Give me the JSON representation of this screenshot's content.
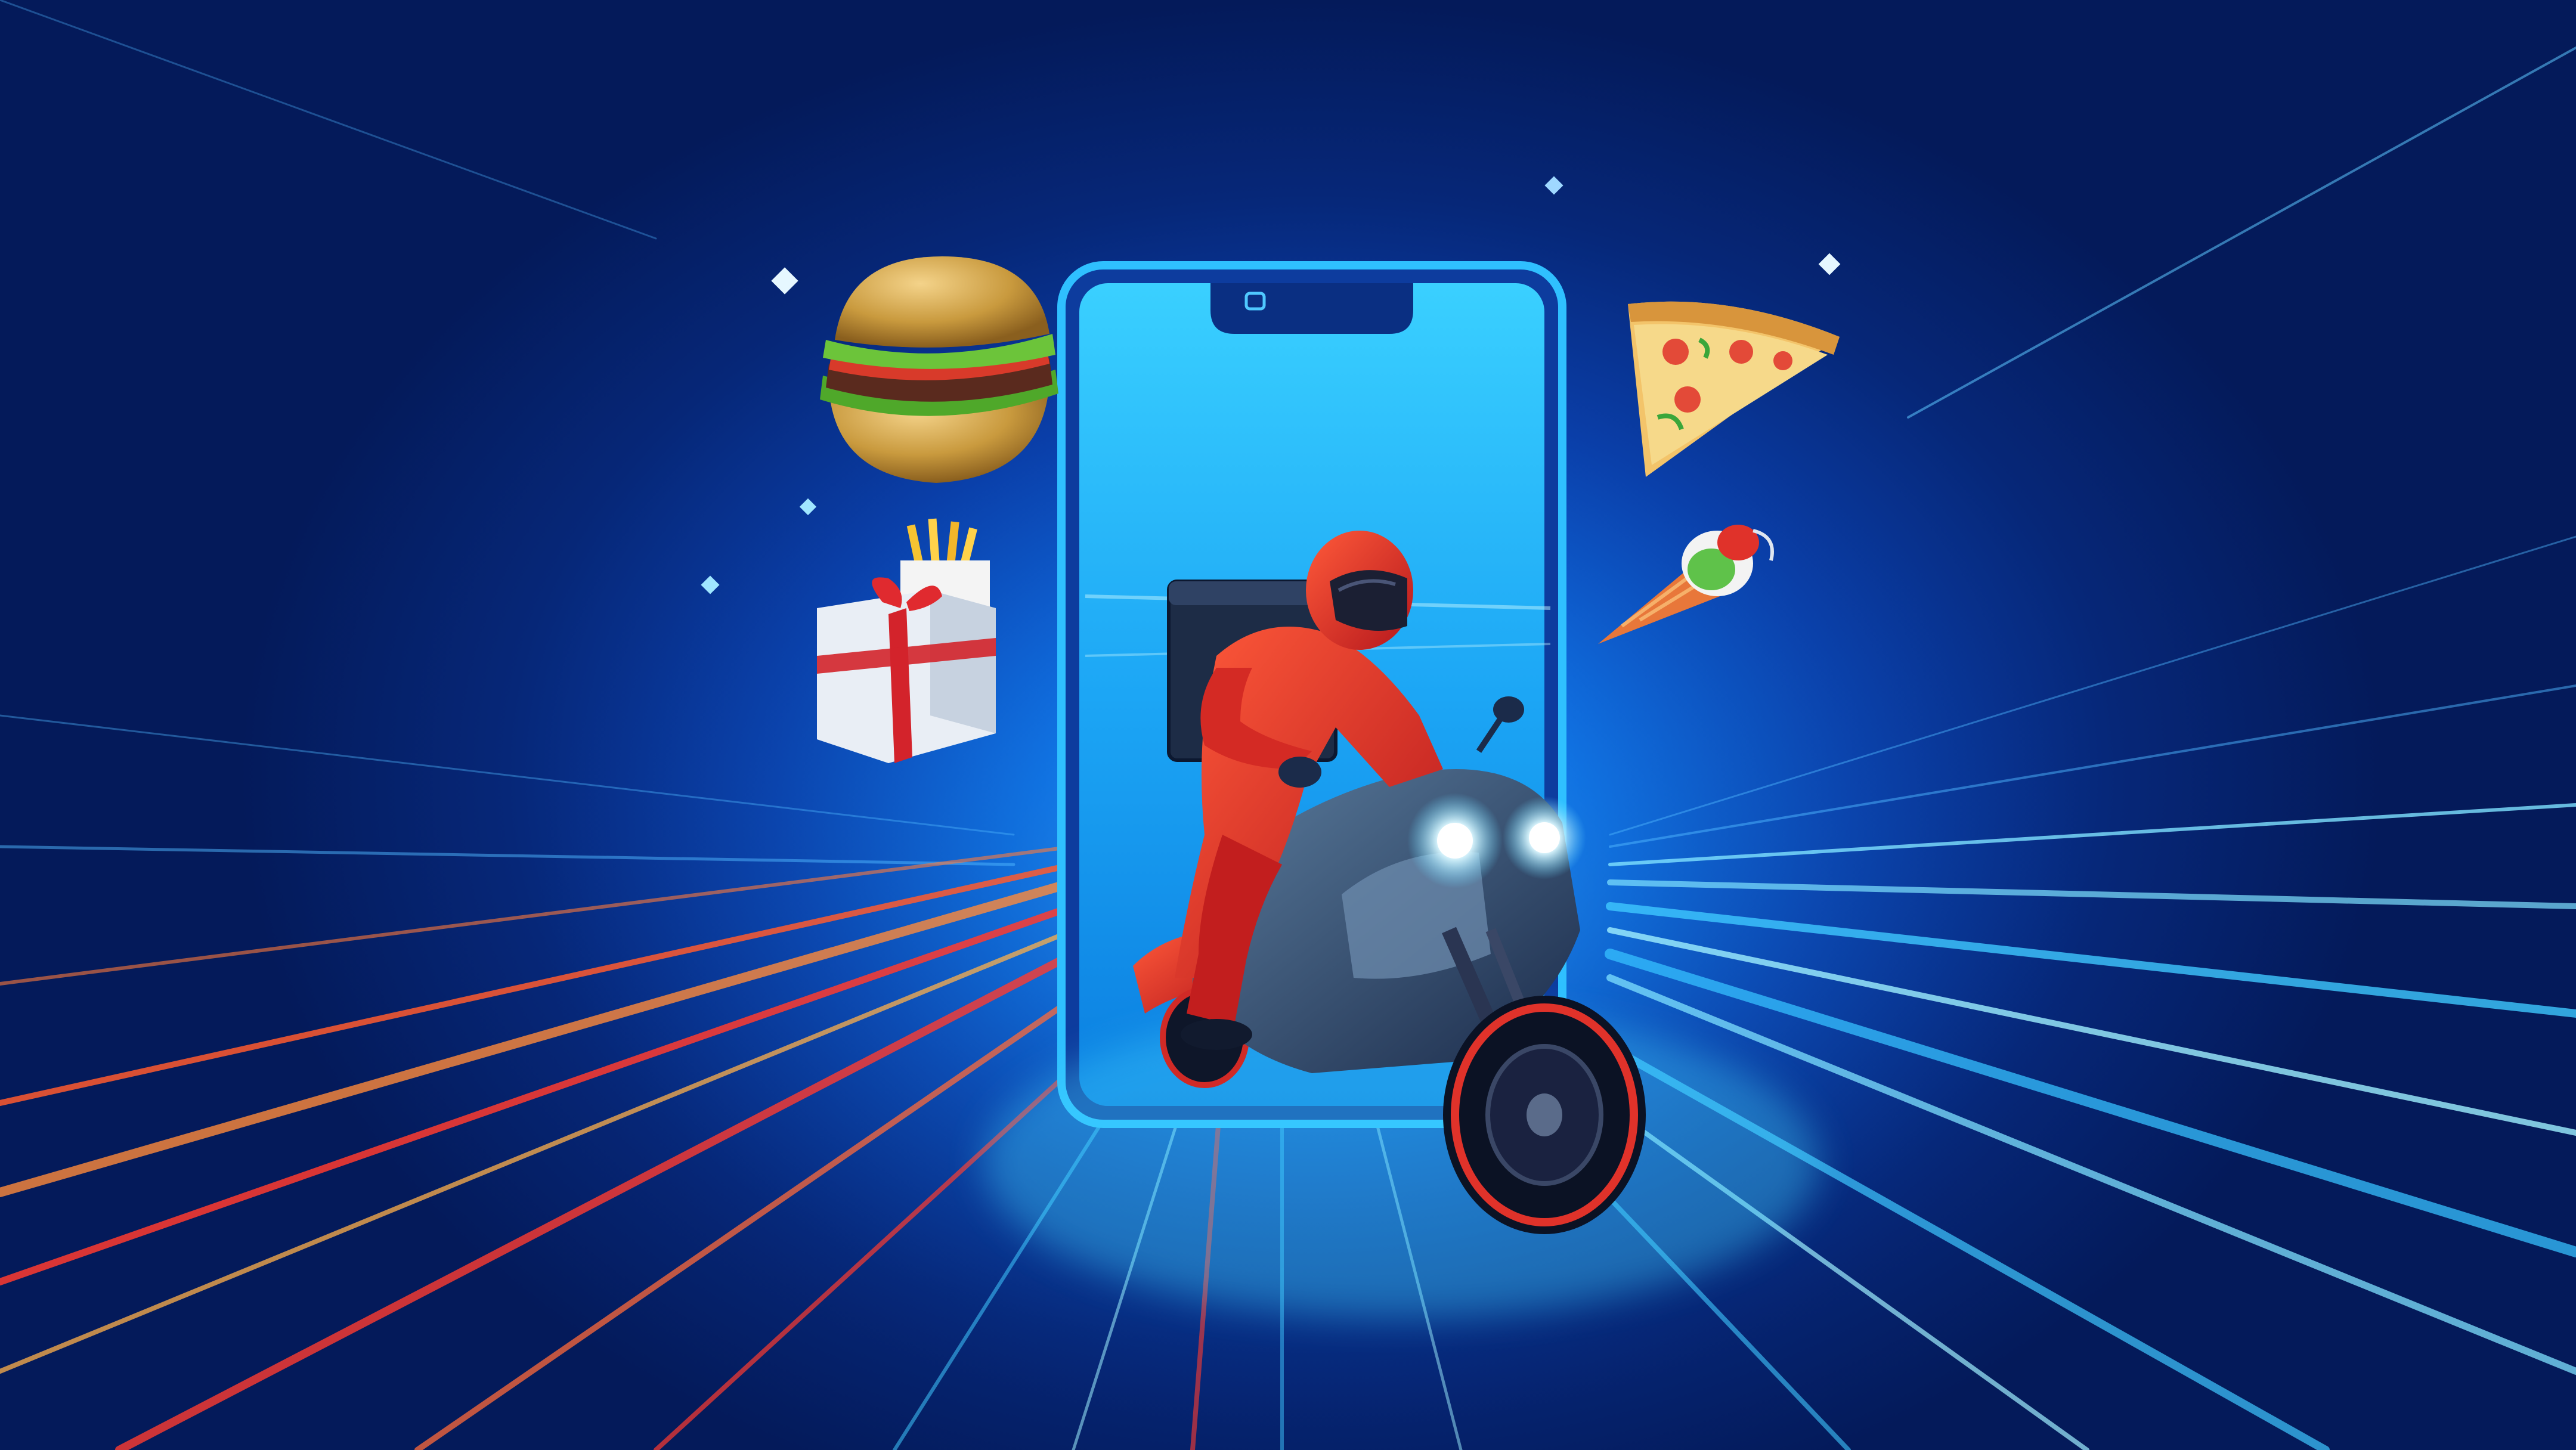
{
  "scene": {
    "subject": "food-delivery-illustration",
    "palette": {
      "background_dark": "#041a5a",
      "background_mid": "#0a3ea8",
      "glow_blue": "#27c4ff",
      "speed_red": "#ff3b2f",
      "speed_orange": "#ff9a3c",
      "rider_red": "#e0322a"
    },
    "elements": [
      "speed-lines",
      "smartphone",
      "delivery-rider",
      "motorcycle",
      "burger-icon",
      "fries-gift-box-icon",
      "pizza-slice-icon",
      "ice-cream-cone-icon",
      "sparkle-icons"
    ]
  }
}
